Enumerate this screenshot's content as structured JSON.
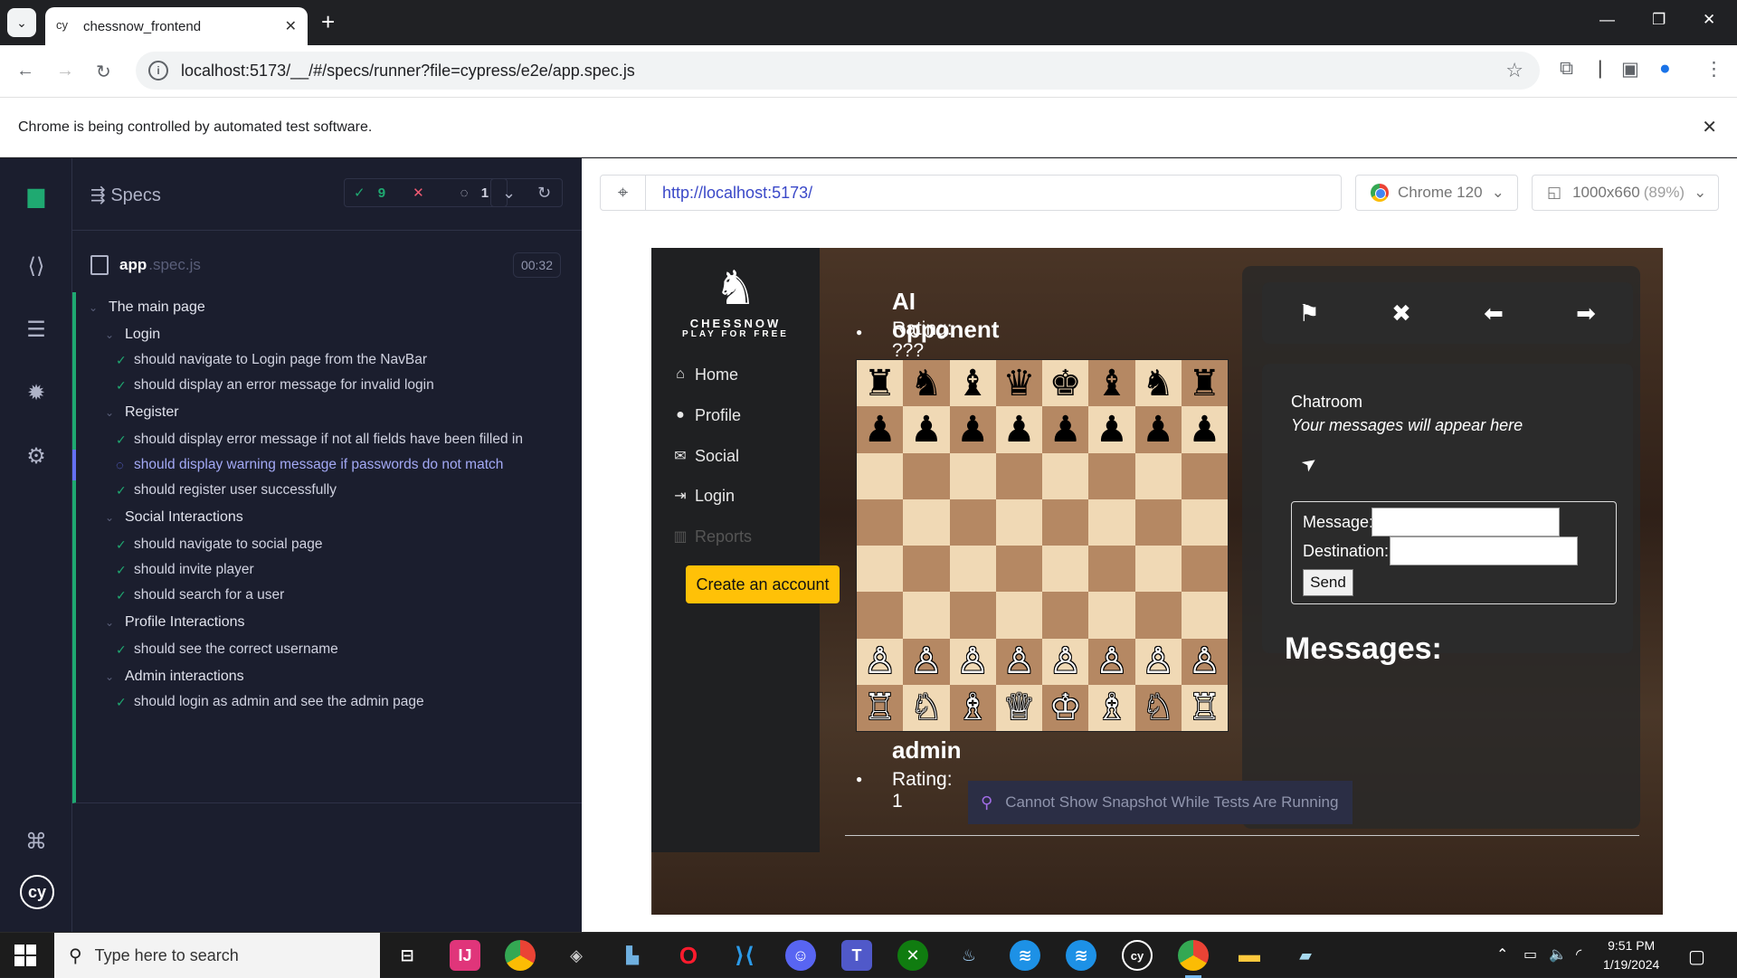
{
  "browser": {
    "tab_title": "chessnow_frontend",
    "new_tab": "+",
    "url": "localhost:5173/__/#/specs/runner?file=cypress/e2e/app.spec.js",
    "automation_notice": "Chrome is being controlled by automated test software."
  },
  "cypress": {
    "specs_title": "Specs",
    "stats": {
      "passed": "9",
      "failed": "",
      "pending": "1"
    },
    "file": {
      "name": "app",
      "ext": ".spec.js",
      "time": "00:32"
    },
    "tree": [
      {
        "kind": "suite",
        "label": "The main page",
        "indent": 0
      },
      {
        "kind": "suite",
        "label": "Login",
        "indent": 1
      },
      {
        "kind": "test",
        "label": "should navigate to Login page from the NavBar",
        "state": "passed"
      },
      {
        "kind": "test",
        "label": "should display an error message for invalid login",
        "state": "passed"
      },
      {
        "kind": "suite",
        "label": "Register",
        "indent": 1
      },
      {
        "kind": "test",
        "label": "should display error message if not all fields have been filled in",
        "state": "passed"
      },
      {
        "kind": "test",
        "label": "should display warning message if passwords do not match",
        "state": "running"
      },
      {
        "kind": "test",
        "label": "should register user successfully",
        "state": "passed"
      },
      {
        "kind": "suite",
        "label": "Social Interactions",
        "indent": 1
      },
      {
        "kind": "test",
        "label": "should navigate to social page",
        "state": "passed"
      },
      {
        "kind": "test",
        "label": "should invite player",
        "state": "passed"
      },
      {
        "kind": "test",
        "label": "should search for a user",
        "state": "passed"
      },
      {
        "kind": "suite",
        "label": "Profile Interactions",
        "indent": 1
      },
      {
        "kind": "test",
        "label": "should see the correct username",
        "state": "passed"
      },
      {
        "kind": "suite",
        "label": "Admin interactions",
        "indent": 1
      },
      {
        "kind": "test",
        "label": "should login as admin and see the admin page",
        "state": "passed"
      }
    ],
    "aut_url": "http://localhost:5173/",
    "browser_label": "Chrome 120",
    "viewport": "1000x660",
    "viewport_scale": "(89%)",
    "snapshot_notice": "Cannot Show Snapshot While Tests Are Running"
  },
  "app": {
    "logo_title": "CHESSNOW",
    "logo_subtitle": "PLAY FOR FREE",
    "nav": [
      {
        "label": "Home",
        "icon": "home-icon"
      },
      {
        "label": "Profile",
        "icon": "user-icon"
      },
      {
        "label": "Social",
        "icon": "envelope-icon"
      },
      {
        "label": "Login",
        "icon": "sign-in-icon"
      },
      {
        "label": "Reports",
        "icon": "bar-chart-icon"
      }
    ],
    "create_account": "Create an account",
    "opponent": {
      "name": "AI opponent",
      "rating": "Rating: ???"
    },
    "player": {
      "name": "admin",
      "rating": "Rating: 1"
    },
    "board_rows": [
      [
        "♜",
        "♞",
        "♝",
        "♛",
        "♚",
        "♝",
        "♞",
        "♜"
      ],
      [
        "♟",
        "♟",
        "♟",
        "♟",
        "♟",
        "♟",
        "♟",
        "♟"
      ],
      [
        "",
        "",
        "",
        "",
        "",
        "",
        "",
        ""
      ],
      [
        "",
        "",
        "",
        "",
        "",
        "",
        "",
        ""
      ],
      [
        "",
        "",
        "",
        "",
        "",
        "",
        "",
        ""
      ],
      [
        "",
        "",
        "",
        "",
        "",
        "",
        "",
        ""
      ],
      [
        "♙",
        "♙",
        "♙",
        "♙",
        "♙",
        "♙",
        "♙",
        "♙"
      ],
      [
        "♖",
        "♘",
        "♗",
        "♕",
        "♔",
        "♗",
        "♘",
        "♖"
      ]
    ],
    "chat": {
      "title": "Chatroom",
      "placeholder": "Your messages will appear here",
      "message_label": "Message:",
      "destination_label": "Destination:",
      "send_label": "Send",
      "messages_heading": "Messages:"
    }
  },
  "taskbar": {
    "search_placeholder": "Type here to search",
    "time": "9:51 PM",
    "date": "1/19/2024"
  }
}
